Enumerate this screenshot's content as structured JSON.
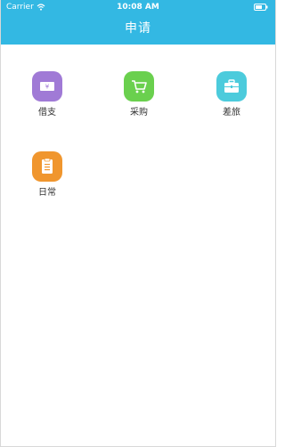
{
  "status_bar": {
    "carrier": "Carrier",
    "time": "10:08 AM"
  },
  "nav": {
    "title": "申请"
  },
  "tiles": [
    {
      "label": "借支",
      "icon": "money-bill-icon",
      "color": "#a07ad6"
    },
    {
      "label": "采购",
      "icon": "shopping-cart-icon",
      "color": "#6ad04e"
    },
    {
      "label": "差旅",
      "icon": "briefcase-icon",
      "color": "#4ccbdc"
    },
    {
      "label": "日常",
      "icon": "document-icon",
      "color": "#f0962e"
    }
  ]
}
